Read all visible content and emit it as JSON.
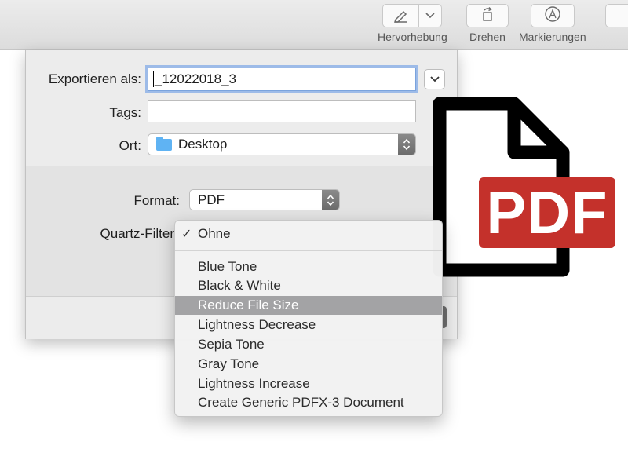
{
  "toolbar": {
    "highlight_label": "Hervorhebung",
    "rotate_label": "Drehen",
    "markup_label": "Markierungen"
  },
  "export": {
    "export_as_label": "Exportieren als:",
    "filename": "_12022018_3",
    "tags_label": "Tags:",
    "tags_value": "",
    "location_label": "Ort:",
    "location_value": "Desktop",
    "format_label": "Format:",
    "format_value": "PDF",
    "quartz_label": "Quartz-Filter"
  },
  "quartz_menu": {
    "checkmark": "✓",
    "selected_index": 3,
    "items": [
      "Ohne",
      "Blue Tone",
      "Black & White",
      "Reduce File Size",
      "Lightness Decrease",
      "Sepia Tone",
      "Gray Tone",
      "Lightness Increase",
      "Create Generic PDFX-3 Document"
    ]
  },
  "pdf_badge": {
    "text": "PDF",
    "color": "#c4312b"
  },
  "icons": [
    "pen-icon",
    "chevron-down-icon",
    "rotate-icon",
    "markup-icon",
    "folder-icon",
    "updown-arrows-icon",
    "pdf-file-icon"
  ]
}
